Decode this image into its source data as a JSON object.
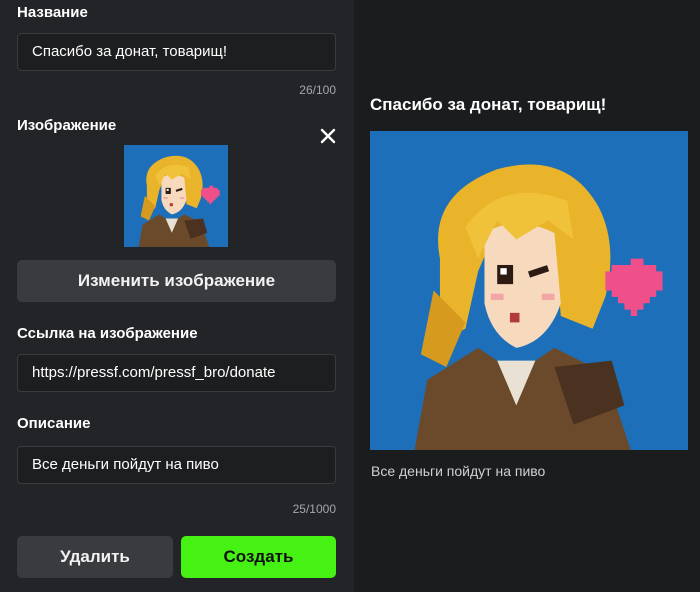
{
  "form": {
    "name_label": "Название",
    "name_value": "Спасибо за донат, товарищ!",
    "name_counter": "26/100",
    "image_label": "Изображение",
    "change_image_button": "Изменить изображение",
    "link_label": "Ссылка на изображение",
    "link_value": "https://pressf.com/pressf_bro/donate",
    "description_label": "Описание",
    "description_value": "Все деньги пойдут на пиво",
    "description_counter": "25/1000",
    "delete_button": "Удалить",
    "create_button": "Создать"
  },
  "preview": {
    "title": "Спасибо за донат, товарищ!",
    "description": "Все деньги пойдут на пиво"
  },
  "icons": {
    "close": "close-icon",
    "heart": "heart-icon"
  },
  "colors": {
    "accent_green": "#46f213",
    "image_bg": "#1c6fb8",
    "hair": "#e9b32a",
    "jacket": "#6b4a2c"
  }
}
